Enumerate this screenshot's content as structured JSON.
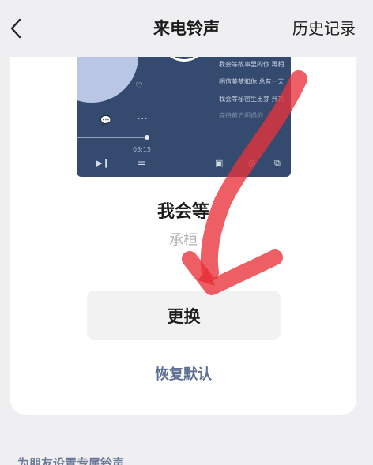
{
  "nav": {
    "title": "来电铃声",
    "right_action": "历史记录",
    "back_icon": "chevron-left-icon"
  },
  "cover": {
    "lyrics": [
      "我会等故事里的你 再相",
      "相信美梦和你 总有一天",
      "我会等秘密生出芽 开花",
      "等待前方相遇的"
    ],
    "time": "03:15",
    "progress_fraction": 0.33,
    "icons": [
      "heart-icon",
      "comment-icon",
      "more-icon",
      "play-next-icon",
      "playlist-icon",
      "lyrics-icon",
      "settings-icon",
      "share-icon"
    ],
    "colors": {
      "background": "#344a6e",
      "disc": "#b9c6e6"
    }
  },
  "song": {
    "title": "我会等",
    "artist": "承桓"
  },
  "actions": {
    "change_label": "更换",
    "restore_label": "恢复默认"
  },
  "footer": {
    "hint": "为朋友设置专属铃声"
  },
  "annotation": {
    "color": "#e8323a",
    "shape": "hand-drawn-arrow"
  }
}
